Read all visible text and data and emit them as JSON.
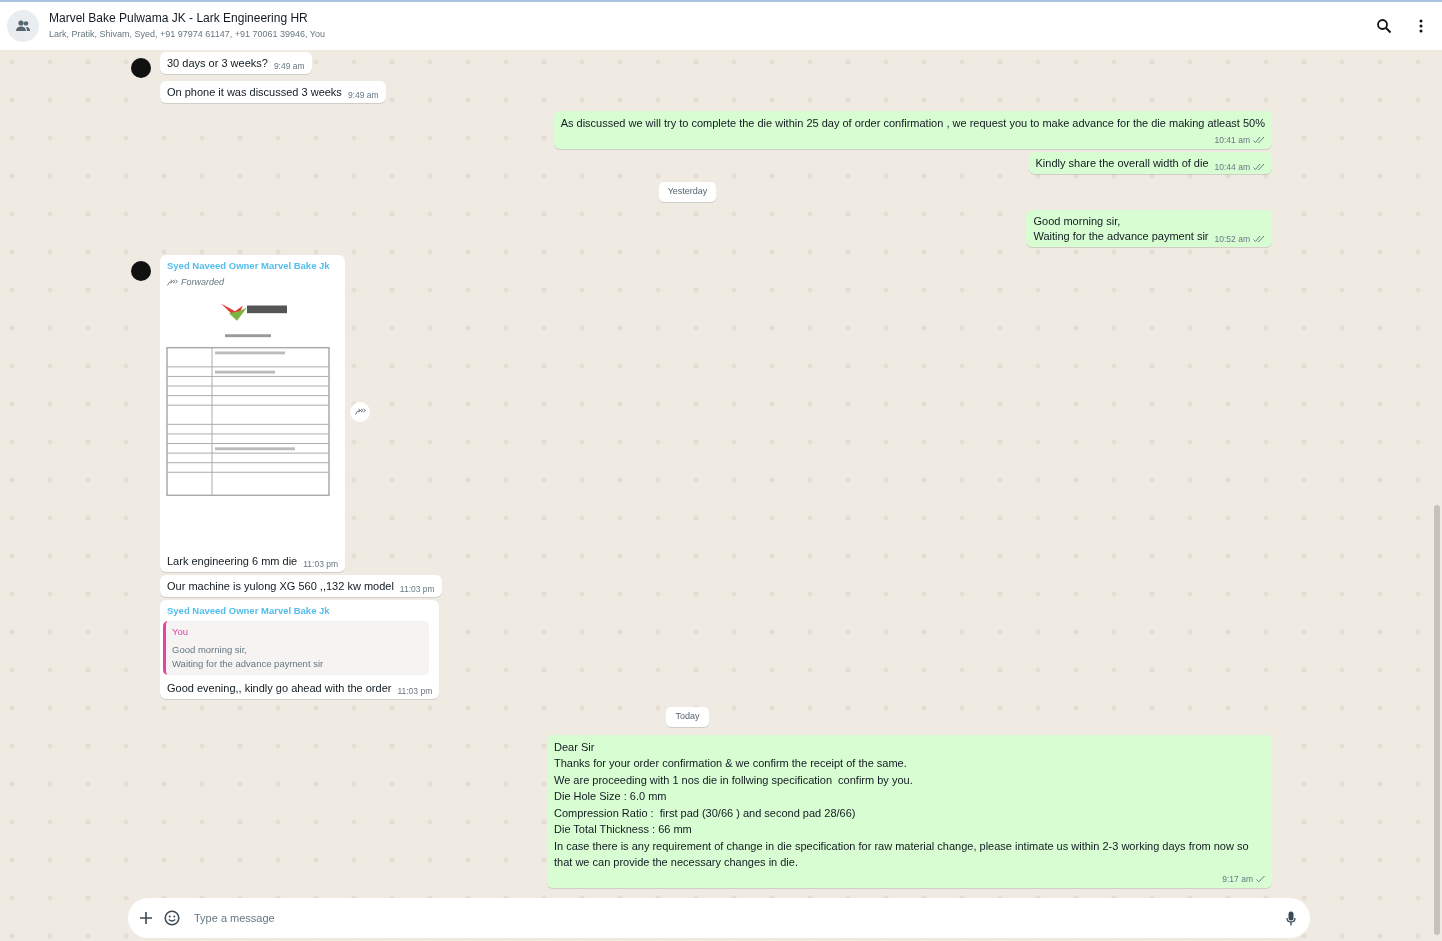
{
  "header": {
    "title": "Marvel Bake Pulwama JK - Lark Engineering HR",
    "subtitle": "Lark, Pratik, Shivam, Syed, +91 97974 61147, +91 70061 39946, You"
  },
  "messages": [
    {
      "kind": "message",
      "outgoing": false,
      "avatar": true,
      "text": "30 days or 3 weeks?",
      "time": "9:49 am"
    },
    {
      "kind": "message",
      "outgoing": false,
      "avatar": false,
      "text": "On phone it was discussed 3 weeks",
      "time": "9:49 am"
    },
    {
      "kind": "message",
      "outgoing": true,
      "text": "As discussed we will try to complete the die within 25 day of order confirmation , we request you to make advance for the die making atleast 50%",
      "time": "10:41 am",
      "delivered": true,
      "time_below": true
    },
    {
      "kind": "message",
      "outgoing": true,
      "text": "Kindly share the overall width of die",
      "time": "10:44 am",
      "delivered": true,
      "time_below": false
    },
    {
      "kind": "date",
      "text": "Yesterday"
    },
    {
      "kind": "message",
      "outgoing": true,
      "text": "Good morning sir,\nWaiting for the advance payment sir",
      "time": "10:52 am",
      "delivered": true,
      "time_below": false
    },
    {
      "kind": "message",
      "outgoing": false,
      "avatar": true,
      "sender": "Syed Naveed Owner Marvel Bake Jk",
      "forwarded_label": "Forwarded",
      "text": "Lark engineering 6 mm die",
      "time": "11:03 pm"
    },
    {
      "kind": "message",
      "outgoing": false,
      "avatar": false,
      "text": "Our machine is yulong XG 560 ,,132 kw model",
      "time": "11:03 pm"
    },
    {
      "kind": "message",
      "outgoing": false,
      "avatar": false,
      "sender": "Syed Naveed Owner Marvel Bake Jk",
      "quote": {
        "author": "You",
        "text": "Good morning sir,\nWaiting for the advance payment sir"
      },
      "text": "Good evening,, kindly go ahead with the order",
      "time": "11:03 pm"
    },
    {
      "kind": "date",
      "text": "Today"
    },
    {
      "kind": "message",
      "outgoing": true,
      "text": "Dear Sir\nThanks for your order confirmation & we confirm the receipt of the same.\nWe are proceeding with 1 nos die in follwing specification  confirm by you.\nDie Hole Size : 6.0 mm\nCompression Ratio :  first pad (30/66 ) and second pad 28/66)\nDie Total Thickness : 66 mm\nIn case there is any requirement of change in die specification for raw material change, please intimate us within 2-3 working days from now so that we can provide the necessary changes in die.",
      "time": "9:17 am",
      "delivered": false,
      "time_below": true
    }
  ],
  "composer": {
    "placeholder": "Type a message"
  }
}
